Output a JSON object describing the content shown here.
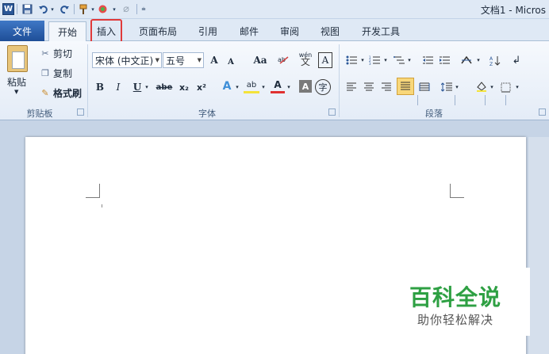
{
  "titlebar": {
    "app_icon": "W",
    "title": "文档1 - Micros",
    "quick_access": [
      "save-icon",
      "undo-icon",
      "redo-icon",
      "format-painter-icon",
      "color-icon",
      "disabled-icon",
      "customize-icon"
    ]
  },
  "tabs": {
    "file": "文件",
    "items": [
      "开始",
      "插入",
      "页面布局",
      "引用",
      "邮件",
      "审阅",
      "视图",
      "开发工具"
    ],
    "active": "开始",
    "highlighted": "插入"
  },
  "clipboard": {
    "paste": "粘贴",
    "cut": "剪切",
    "copy": "复制",
    "format_painter": "格式刷",
    "group_label": "剪贴板"
  },
  "font": {
    "font_name": "宋体 (中文正)",
    "font_size": "五号",
    "grow": "A",
    "shrink": "A",
    "change_case": "Aa",
    "phonetic": "wén",
    "char_border": "A",
    "bold": "B",
    "italic": "I",
    "underline": "U",
    "strike": "abe",
    "subscript": "x₂",
    "superscript": "x²",
    "effects": "A",
    "highlight": "ab",
    "font_color": "A",
    "char_shading": "A",
    "enclose": "字",
    "group_label": "字体"
  },
  "paragraph": {
    "group_label": "段落"
  },
  "watermark": {
    "main": "百科全说",
    "sub": "助你轻松解决"
  },
  "colors": {
    "file_tab": "#2a5ca5",
    "highlight_border": "#e03a3a",
    "watermark_green": "#2ea043"
  }
}
